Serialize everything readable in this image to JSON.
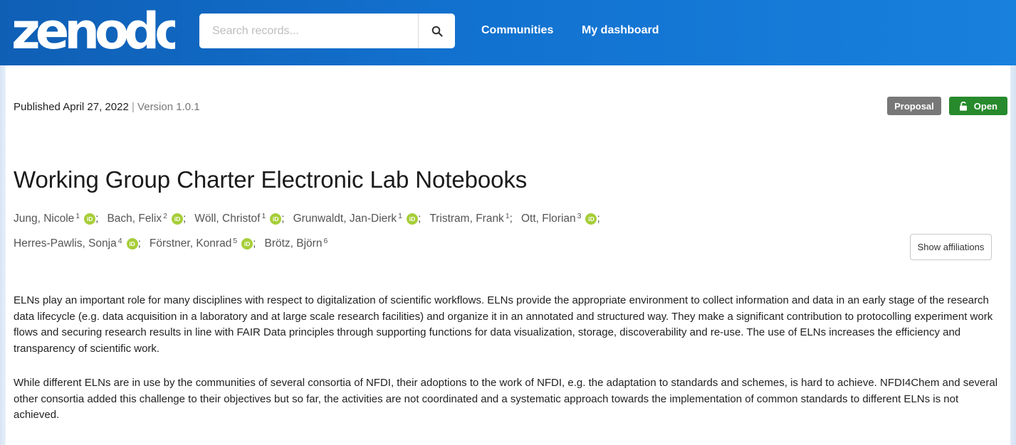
{
  "header": {
    "logo_text": "zenodo",
    "search": {
      "placeholder": "Search records..."
    },
    "nav": {
      "communities": "Communities",
      "dashboard": "My dashboard"
    }
  },
  "record": {
    "published": "Published April 27, 2022",
    "separator": "|",
    "version": "Version 1.0.1",
    "badges": {
      "type": "Proposal",
      "access": "Open"
    },
    "title": "Working Group Charter Electronic Lab Notebooks",
    "authors": [
      {
        "name": "Jung, Nicole",
        "aff": "1",
        "orcid": true
      },
      {
        "name": "Bach, Felix",
        "aff": "2",
        "orcid": true
      },
      {
        "name": "Wöll, Christof",
        "aff": "1",
        "orcid": true
      },
      {
        "name": "Grunwaldt, Jan-Dierk",
        "aff": "1",
        "orcid": true
      },
      {
        "name": "Tristram, Frank",
        "aff": "1",
        "orcid": false
      },
      {
        "name": "Ott, Florian",
        "aff": "3",
        "orcid": true
      },
      {
        "name": "Herres-Pawlis, Sonja",
        "aff": "4",
        "orcid": true
      },
      {
        "name": "Förstner, Konrad",
        "aff": "5",
        "orcid": true
      },
      {
        "name": "Brötz, Björn",
        "aff": "6",
        "orcid": false
      }
    ],
    "show_affiliations": "Show affiliations",
    "abstract": [
      "ELNs play an important role for many disciplines with respect to digitalization of scientific workflows. ELNs provide the appropriate environment to collect information and data in an early stage of the research data lifecycle (e.g. data acquisition in a laboratory and at large scale research facilities) and organize it in an annotated and structured way. They make a significant contribution to protocolling experiment work flows and  securing research results in line with FAIR Data principles through supporting functions for data visualization, storage, discoverability and re-use. The use of ELNs increases the efficiency and transparency of scientific work.",
      "While different ELNs are in use by the communities of several consortia of NFDI, their adoptions to the work of NFDI, e.g. the adaptation to standards and schemes, is hard to achieve. NFDI4Chem and several other consortia added this challenge to their objectives but so far, the activities are not coordinated and a systematic approach towards the implementation of common standards to different ELNs is not achieved."
    ]
  },
  "colors": {
    "header_blue": "#1271cf",
    "proposal_badge": "#787878",
    "open_badge": "#278a2c",
    "orcid_green": "#a6ce39"
  }
}
